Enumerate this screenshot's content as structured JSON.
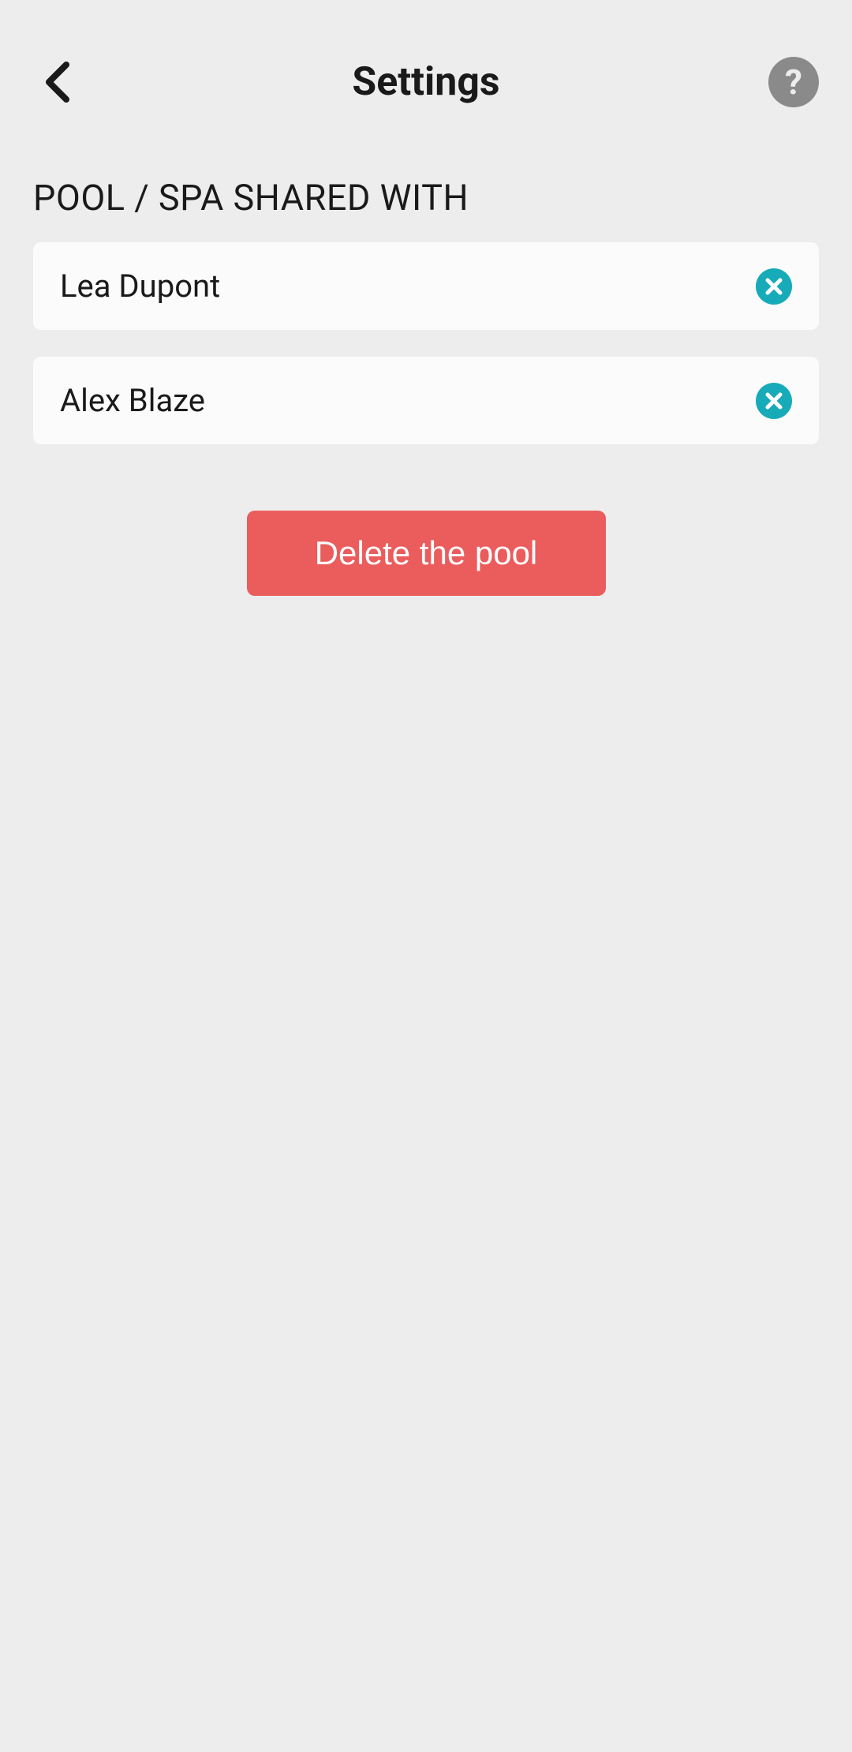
{
  "header": {
    "title": "Settings"
  },
  "section": {
    "heading": "POOL / SPA SHARED WITH"
  },
  "shared_users": [
    {
      "name": "Lea Dupont"
    },
    {
      "name": "Alex Blaze"
    }
  ],
  "actions": {
    "delete_label": "Delete the pool"
  }
}
